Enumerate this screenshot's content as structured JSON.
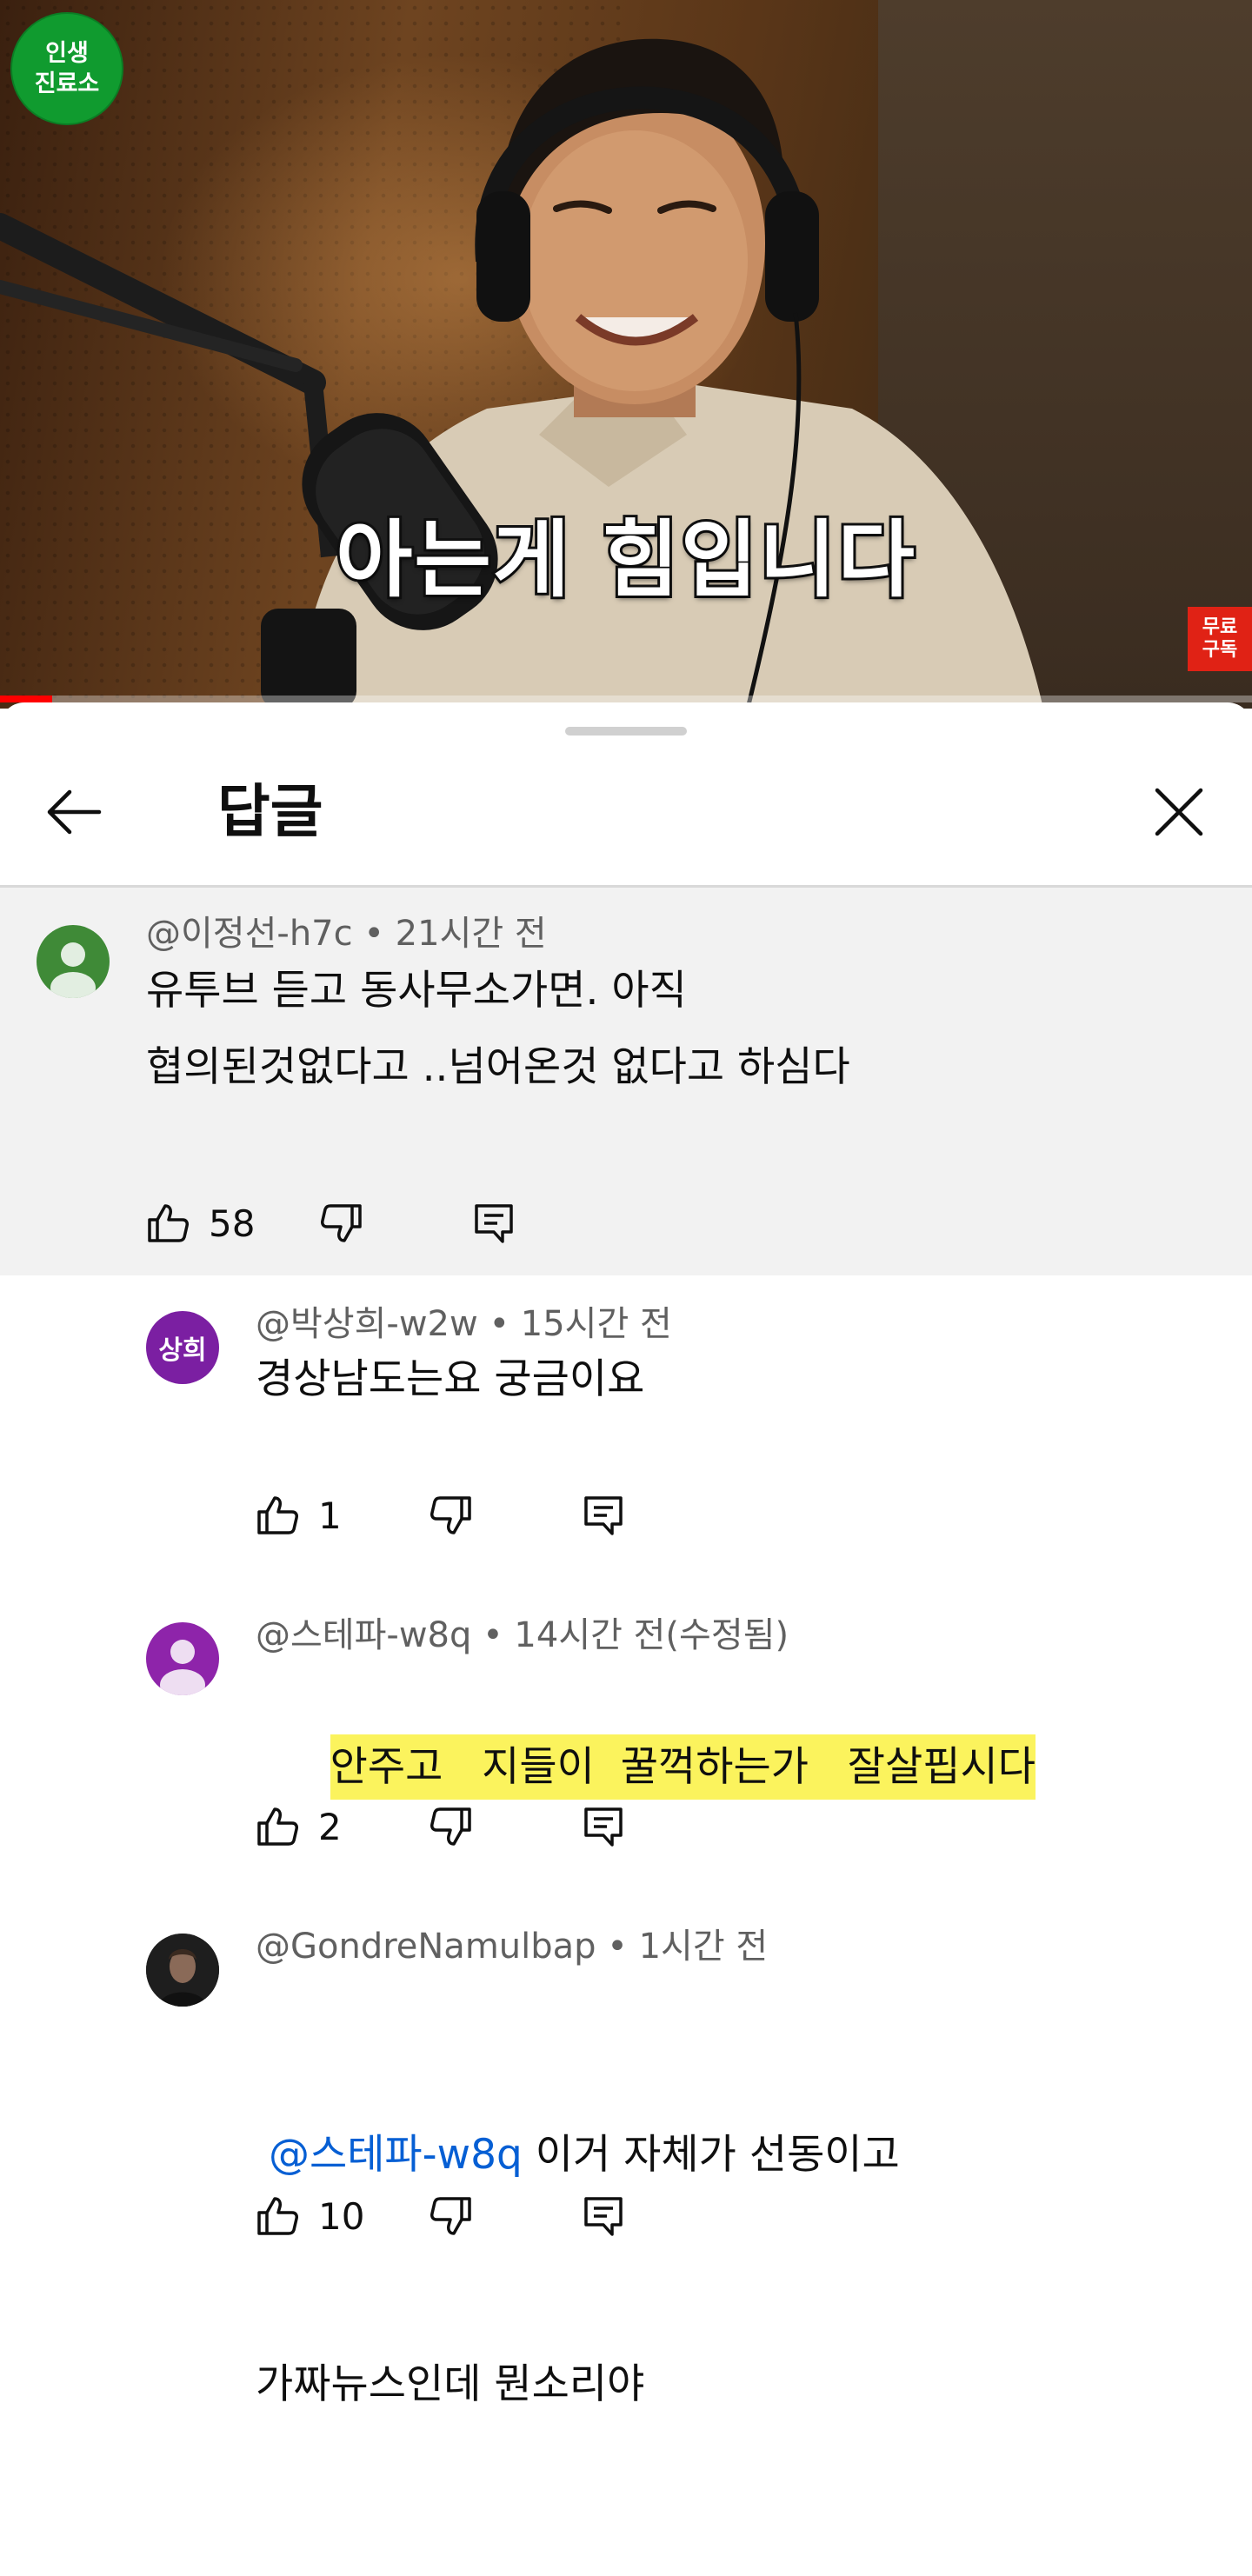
{
  "video": {
    "channel_logo_line1": "인생",
    "channel_logo_line2": "진료소",
    "subtitle": "아는게 힘입니다",
    "subscribe_badge_line1": "무료",
    "subscribe_badge_line2": "구독",
    "progress_fraction": 0.042,
    "colors": {
      "progress": "#ff0000",
      "logo": "#109b2f",
      "badge": "#e02215"
    }
  },
  "sheet": {
    "title": "답글",
    "back_icon": "arrow-left-icon",
    "close_icon": "close-icon"
  },
  "parent_comment": {
    "author": "@이정선-h7c",
    "time": "21시간 전",
    "lines": [
      "유투브 듣고 동사무소가면. 아직",
      "협의된것없다고 ..넘어온것 없다고 하심다"
    ],
    "likes": "58",
    "avatar_color": "#3f8a37"
  },
  "replies": [
    {
      "author": "@박상희-w2w",
      "time": "15시간 전",
      "avatar_text": "상희",
      "avatar_color": "#7b1fa2",
      "lines": [
        "경상남도는요 궁금이요"
      ],
      "likes": "1"
    },
    {
      "author": "@스테파-w8q",
      "time": "14시간 전(수정됨)",
      "avatar_color": "#8e24aa",
      "lines": [
        "안주고   지들이  꿀꺽하는가   잘살핍시다"
      ],
      "highlight_color": "#fbf35d",
      "likes": "2"
    },
    {
      "author": "@GondreNamulbap",
      "time": "1시간 전",
      "avatar_color": "#2b2b2b",
      "mention": "@스테파-w8q",
      "line1_rest": " 이거 자체가 선동이고",
      "line2": "가짜뉴스인데 뭔소리야",
      "mention_color": "#065fd4",
      "likes": "10"
    }
  ]
}
